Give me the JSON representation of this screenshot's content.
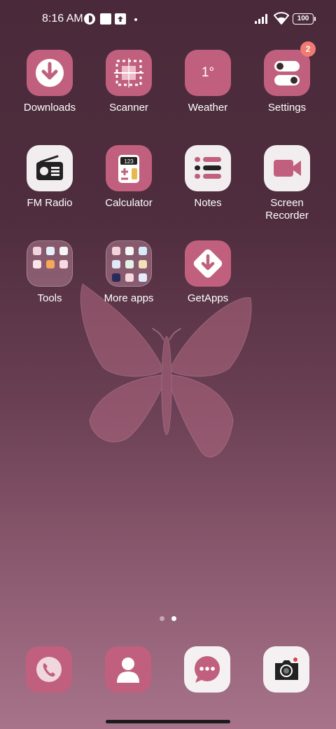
{
  "status_bar": {
    "time": "8:16 AM",
    "battery": "100",
    "icons": [
      "data-saver-icon",
      "notification-square-icon",
      "upload-icon",
      "dot-icon",
      "signal-icon",
      "wifi-icon",
      "battery-icon"
    ]
  },
  "apps": [
    {
      "label": "Downloads",
      "icon": "download-icon"
    },
    {
      "label": "Scanner",
      "icon": "scanner-icon"
    },
    {
      "label": "Weather",
      "icon": "weather-icon",
      "text": "1°"
    },
    {
      "label": "Settings",
      "icon": "settings-toggle-icon",
      "badge": "2"
    },
    {
      "label": "FM Radio",
      "icon": "radio-icon"
    },
    {
      "label": "Calculator",
      "icon": "calculator-icon",
      "text": "123"
    },
    {
      "label": "Notes",
      "icon": "notes-icon"
    },
    {
      "label": "Screen\nRecorder",
      "icon": "video-camera-icon"
    },
    {
      "label": "Tools",
      "icon": "folder-icon"
    },
    {
      "label": "More apps",
      "icon": "folder-icon"
    },
    {
      "label": "GetApps",
      "icon": "getapps-icon"
    }
  ],
  "dock": [
    {
      "name": "phone",
      "icon": "phone-icon"
    },
    {
      "name": "contacts",
      "icon": "contacts-icon"
    },
    {
      "name": "messages",
      "icon": "chat-icon"
    },
    {
      "name": "camera",
      "icon": "camera-icon"
    }
  ],
  "page_indicator": {
    "pages": 2,
    "current": 2
  },
  "colors": {
    "accent": "#c0607e",
    "badge": "#ef7b72",
    "background_top": "#4a2a3a",
    "background_bottom": "#a7738a"
  }
}
